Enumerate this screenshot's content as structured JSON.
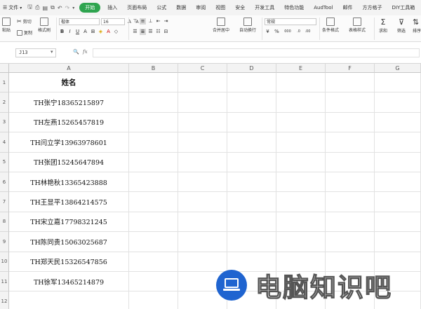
{
  "menubar": {
    "file_label": "文件",
    "tabs": [
      "开始",
      "插入",
      "页面布局",
      "公式",
      "数据",
      "审阅",
      "视图",
      "安全",
      "开发工具",
      "特色功能",
      "AudTool",
      "邮件",
      "方方格子",
      "DIY工具箱"
    ],
    "active_tab": "开始"
  },
  "ribbon": {
    "paste_label": "粘贴",
    "cut_label": "剪切",
    "copy_label": "复制",
    "format_painter_label": "格式刷",
    "font_name": "楷体",
    "font_size": "16",
    "bold_label": "B",
    "italic_label": "I",
    "underline_label": "U",
    "merge_label": "合并居中",
    "wrap_label": "自动换行",
    "number_format": "常规",
    "currency_symbol": "¥",
    "percent_symbol": "%",
    "thousands_symbol": "000",
    "cond_format_label": "条件格式",
    "table_style_label": "表格样式",
    "sum_label": "求和",
    "filter_label": "筛选",
    "sort_label": "排序"
  },
  "formula_bar": {
    "name_box": "J13",
    "fx_label": "fx",
    "value": ""
  },
  "grid": {
    "columns": [
      "A",
      "B",
      "C",
      "D",
      "E",
      "F",
      "G"
    ],
    "rows": [
      "1",
      "2",
      "3",
      "4",
      "5",
      "6",
      "7",
      "8",
      "9",
      "10",
      "11",
      "12"
    ],
    "cells_A": [
      "姓名",
      "TH张宁18365215897",
      "TH左燕15265457819",
      "TH闫立学13963978601",
      "TH张团15245647894",
      "TH林艳秋13365423888",
      "TH王显平13864214575",
      "TH宋立嘉17798321245",
      "TH陈同贵15063025687",
      "TH郑天民15326547856",
      "TH徐军13465214879",
      ""
    ]
  },
  "watermark": {
    "text": "电脑知识吧",
    "logo_color": "#1f64d0"
  },
  "colors": {
    "accent": "#2ea44f"
  }
}
